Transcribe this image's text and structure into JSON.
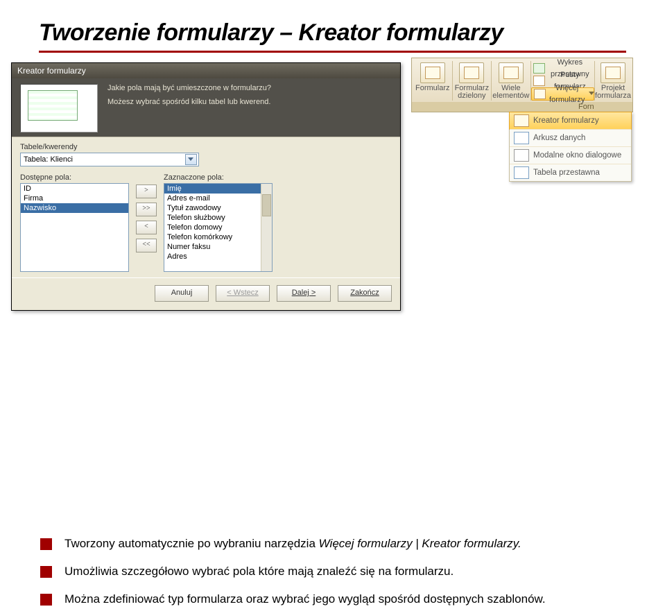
{
  "title": "Tworzenie formularzy – Kreator formularzy",
  "wizard": {
    "window_title": "Kreator formularzy",
    "question": "Jakie pola mają być umieszczone w formularzu?",
    "hint": "Możesz wybrać spośród kilku tabel lub kwerend.",
    "tables_label": "Tabele/kwerendy",
    "combo_value": "Tabela: Klienci",
    "available_label": "Dostępne pola:",
    "selected_label": "Zaznaczone pola:",
    "available": [
      "ID",
      "Firma",
      "Nazwisko"
    ],
    "selected": [
      "Imię",
      "Adres e-mail",
      "Tytuł zawodowy",
      "Telefon służbowy",
      "Telefon domowy",
      "Telefon komórkowy",
      "Numer faksu",
      "Adres"
    ],
    "btn_add": ">",
    "btn_add_all": ">>",
    "btn_remove": "<",
    "btn_remove_all": "<<",
    "footer": {
      "cancel": "Anuluj",
      "back": "< Wstecz",
      "next": "Dalej >",
      "finish": "Zakończ"
    }
  },
  "ribbon": {
    "groups": [
      {
        "label": "Formularz"
      },
      {
        "label": "Formularz dzielony"
      },
      {
        "label": "Wiele elementów"
      }
    ],
    "side_items": [
      {
        "label": "Wykres przestawny",
        "hi": false
      },
      {
        "label": "Pusty formularz",
        "hi": false
      },
      {
        "label": "Więcej formularzy",
        "hi": true
      }
    ],
    "design_label": "Projekt formularza",
    "group_caption": "Forn",
    "dropdown": [
      "Kreator formularzy",
      "Arkusz danych",
      "Modalne okno dialogowe",
      "Tabela przestawna"
    ]
  },
  "bullets": [
    {
      "prefix": "Tworzony automatycznie po wybraniu narzędzia ",
      "em": "Więcej formularzy | Kreator formularzy.",
      "suffix": ""
    },
    {
      "prefix": "Umożliwia szczegółowo wybrać pola które mają znaleźć się na formularzu.",
      "em": "",
      "suffix": ""
    },
    {
      "prefix": "Można zdefiniować typ formularza oraz wybrać jego wygląd spośród dostępnych szablonów.",
      "em": "",
      "suffix": ""
    }
  ]
}
